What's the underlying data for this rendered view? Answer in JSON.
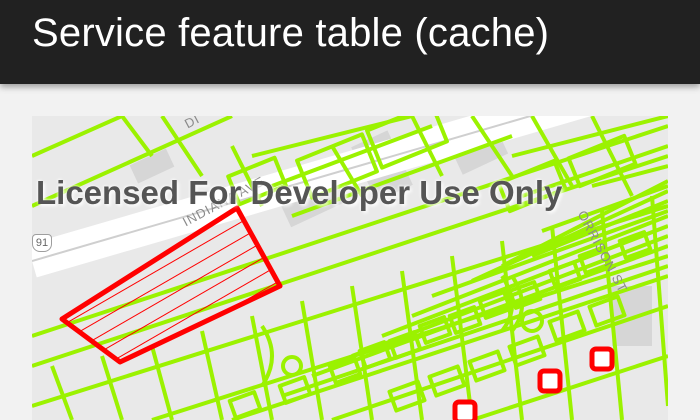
{
  "app_bar": {
    "title": "Service feature table (cache)"
  },
  "map": {
    "watermark": "Licensed For Developer Use Only",
    "route_shield": "91",
    "street_labels": {
      "avenue": "INDIANA AVE",
      "street": "ORRISON ST",
      "partial": "DI"
    },
    "colors": {
      "parcel_outline": "#9bf200",
      "selected_feature": "#ff0000",
      "basemap": "#e9e9e9",
      "app_bar": "#212121"
    }
  }
}
